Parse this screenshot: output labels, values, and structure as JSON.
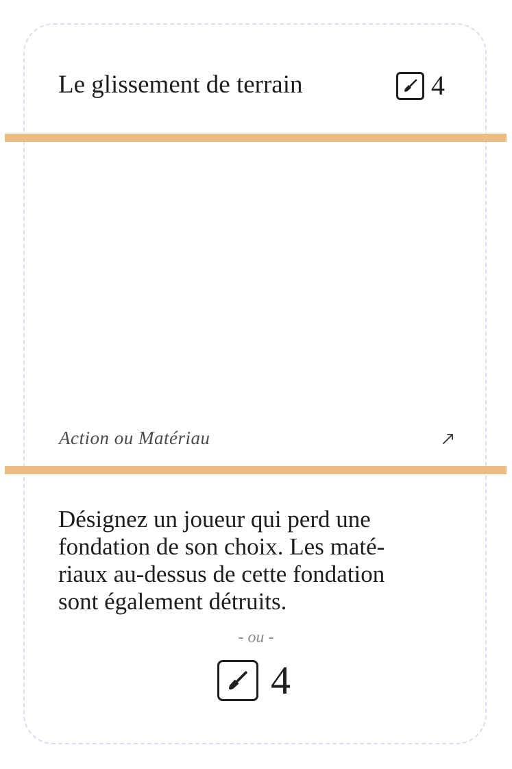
{
  "card": {
    "title": "Le glissement de terrain",
    "cost": "4",
    "cost_icon": "shovel-icon",
    "type_label": "Action ou Matériau",
    "type_icon": "arrow-up-right-icon",
    "description_lines": [
      "Désignez un joueur qui perd une",
      "fondation de son choix. Les maté-",
      "riaux au-dessus de cette fondation",
      "sont également détruits."
    ],
    "separator": "- ou -",
    "alt_cost": "4",
    "alt_cost_icon": "shovel-icon"
  },
  "colors": {
    "band": "#ecbc82",
    "cut_line": "#dcdcf5",
    "text": "#1e1e1e"
  }
}
